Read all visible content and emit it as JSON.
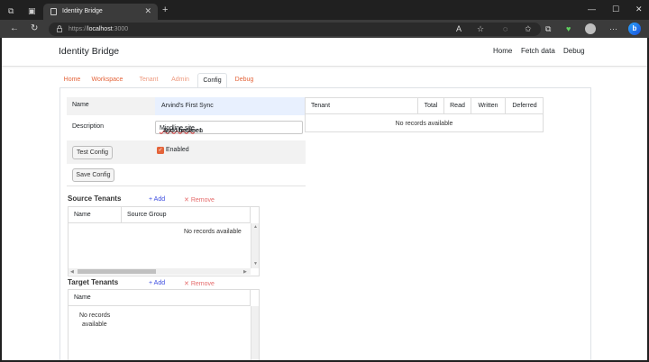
{
  "browser": {
    "tab_title": "Identity Bridge",
    "tab_close": "✕",
    "new_tab": "+",
    "url_scheme": "https://",
    "url_host": "localhost",
    "url_port": ":3000",
    "minimize": "—",
    "maximize": "☐",
    "close": "✕"
  },
  "navbar": {
    "brand": "Identity Bridge",
    "links": [
      "Home",
      "Fetch data",
      "Debug"
    ]
  },
  "tabs": [
    "Home",
    "Workspace",
    "Tenant",
    "Admin",
    "Config",
    "Debug"
  ],
  "active_tab": "Config",
  "config": {
    "name_label": "Name",
    "name_value": "Arvind's First Sync",
    "description_label": "Description",
    "description_prefix": "Sync between ",
    "description_underlined": "Mindline.site",
    "description_suffix": " and Mindline1",
    "test_button": "Test Config",
    "enabled_label": "Enabled",
    "enabled": true,
    "save_button": "Save Config"
  },
  "source_tenants": {
    "title": "Source Tenants",
    "add": "Add",
    "remove": "Remove",
    "columns": [
      "Name",
      "Source Group"
    ],
    "empty": "No records available"
  },
  "target_tenants": {
    "title": "Target Tenants",
    "add": "Add",
    "remove": "Remove",
    "columns": [
      "Name"
    ],
    "empty_line1": "No records",
    "empty_line2": "available"
  },
  "stats_grid": {
    "columns": [
      "Tenant",
      "Total",
      "Read",
      "Written",
      "Deferred"
    ],
    "empty": "No records available"
  },
  "colors": {
    "accent": "#e4643a",
    "link_add": "#3c4de0",
    "link_remove": "#e56b6b"
  }
}
